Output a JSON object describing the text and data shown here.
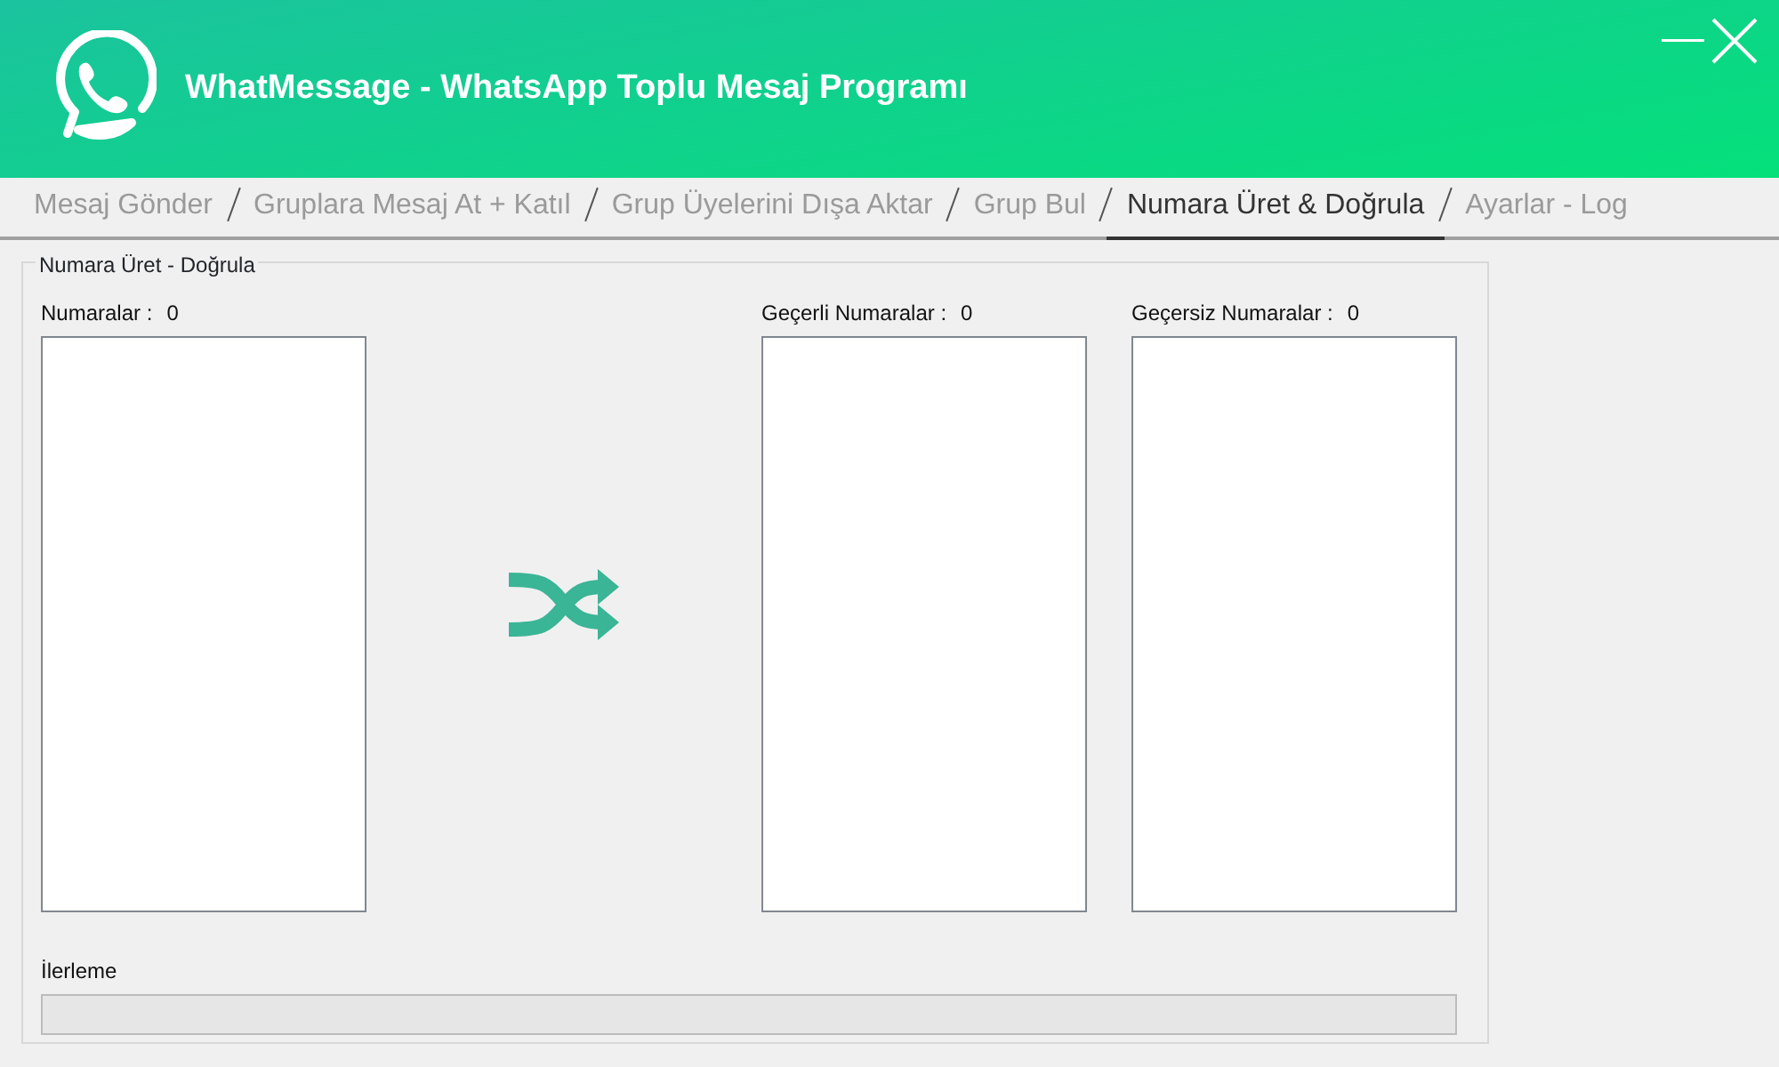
{
  "window": {
    "title": "WhatMessage - WhatsApp Toplu Mesaj Programı"
  },
  "tabs": [
    {
      "label": "Mesaj Gönder",
      "selected": false
    },
    {
      "label": "Gruplara Mesaj At + Katıl",
      "selected": false
    },
    {
      "label": "Grup Üyelerini Dışa Aktar",
      "selected": false
    },
    {
      "label": "Grup Bul",
      "selected": false
    },
    {
      "label": "Numara Üret & Doğrula",
      "selected": true
    },
    {
      "label": "Ayarlar - Log",
      "selected": false
    }
  ],
  "group": {
    "title": "Numara Üret - Doğrula",
    "lists": [
      {
        "label": "Numaralar :",
        "count": "0"
      },
      {
        "label": "Geçerli Numaralar :",
        "count": "0"
      },
      {
        "label": "Geçersiz Numaralar :",
        "count": "0"
      }
    ],
    "progress": {
      "label": "İlerleme",
      "level": 0
    }
  }
}
